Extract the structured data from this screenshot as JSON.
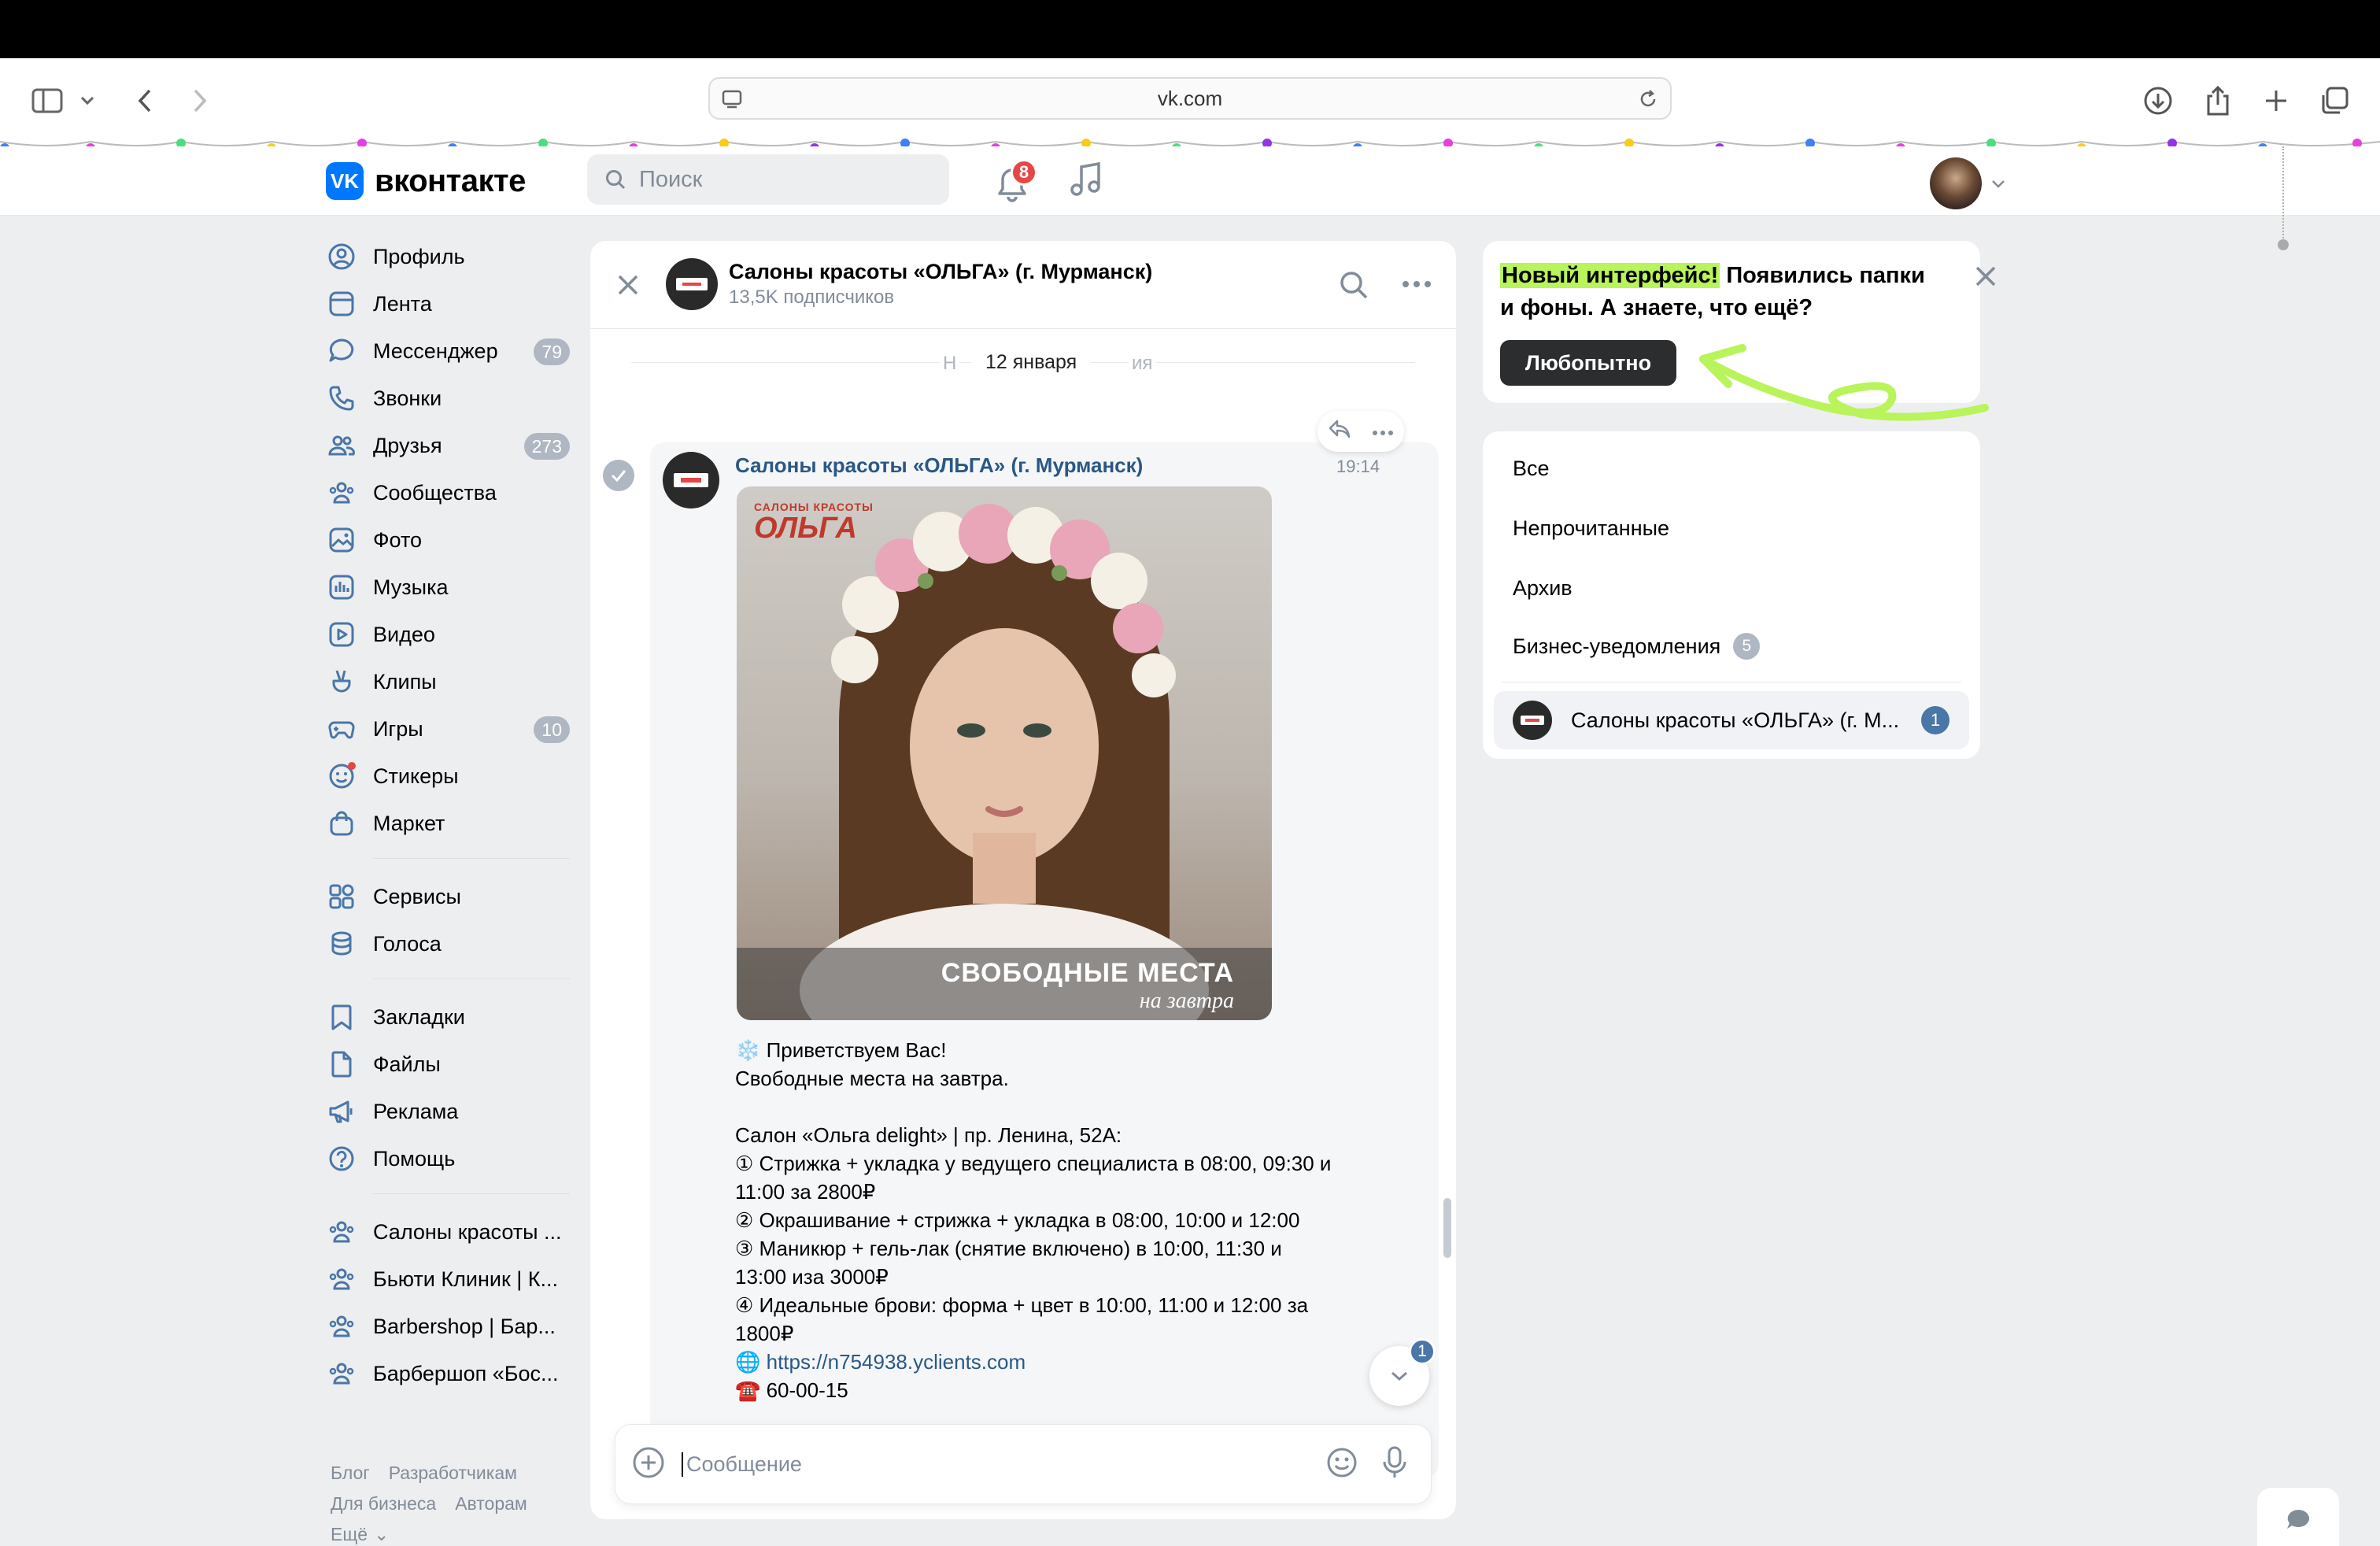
{
  "browser": {
    "url": "vk.com"
  },
  "header": {
    "logo_text": "вконтакте",
    "logo_mark": "VK",
    "search_placeholder": "Поиск",
    "notifications_count": "8"
  },
  "nav": {
    "items": [
      {
        "label": "Профиль",
        "icon": "user-circle-icon"
      },
      {
        "label": "Лента",
        "icon": "feed-icon"
      },
      {
        "label": "Мессенджер",
        "icon": "message-icon",
        "count": "79"
      },
      {
        "label": "Звонки",
        "icon": "phone-icon"
      },
      {
        "label": "Друзья",
        "icon": "friends-icon",
        "count": "273"
      },
      {
        "label": "Сообщества",
        "icon": "communities-icon"
      },
      {
        "label": "Фото",
        "icon": "photo-icon"
      },
      {
        "label": "Музыка",
        "icon": "music-icon"
      },
      {
        "label": "Видео",
        "icon": "video-icon"
      },
      {
        "label": "Клипы",
        "icon": "clips-icon"
      },
      {
        "label": "Игры",
        "icon": "games-icon",
        "count": "10"
      },
      {
        "label": "Стикеры",
        "icon": "stickers-icon"
      },
      {
        "label": "Маркет",
        "icon": "market-icon"
      }
    ],
    "services": [
      {
        "label": "Сервисы",
        "icon": "services-icon"
      },
      {
        "label": "Голоса",
        "icon": "votes-icon"
      }
    ],
    "tools": [
      {
        "label": "Закладки",
        "icon": "bookmark-icon"
      },
      {
        "label": "Файлы",
        "icon": "file-icon"
      },
      {
        "label": "Реклама",
        "icon": "megaphone-icon"
      },
      {
        "label": "Помощь",
        "icon": "help-icon"
      }
    ],
    "groups": [
      {
        "label": "Салоны красоты ...",
        "icon": "communities-icon"
      },
      {
        "label": "Бьюти Клиник | К...",
        "icon": "communities-icon"
      },
      {
        "label": "Barbershop | Бар...",
        "icon": "communities-icon"
      },
      {
        "label": "Барбершоп «Бос...",
        "icon": "communities-icon"
      }
    ]
  },
  "footer": {
    "links_row1": [
      "Блог",
      "Разработчикам"
    ],
    "links_row2": [
      "Для бизнеса",
      "Авторам"
    ],
    "more": "Ещё"
  },
  "chat": {
    "title": "Салоны красоты «ОЛЬГА» (г. Мурманск)",
    "subtitle": "13,5K подписчиков",
    "date_divider": "12 января",
    "date_divider_left": "Н",
    "date_divider_right": "ия",
    "message": {
      "sender": "Салоны красоты «ОЛЬГА» (г. Мурманск)",
      "time": "19:14",
      "photo": {
        "logo_small": "САЛОНЫ КРАСОТЫ",
        "logo_big": "ОЛЬГА",
        "caption_main": "СВОБОДНЫЕ МЕСТА",
        "caption_sub": "на завтра"
      },
      "lines": [
        "❄️ Приветствуем Вас!",
        "Свободные места на завтра.",
        "",
        "Салон «Ольга delight» | пр. Ленина, 52А:",
        "① Стрижка + укладка у ведущего специалиста в 08:00, 09:30 и 11:00 за 2800₽",
        "② Окрашивание + стрижка + укладка в 08:00, 10:00 и 12:00",
        "③ Маникюр + гель-лак (снятие включено) в 10:00, 11:30 и 13:00 иза 3000₽",
        "④ Идеальные брови: форма + цвет в 10:00, 11:00 и 12:00 за 1800₽"
      ],
      "link": "https://n754938.yclients.com",
      "phone": "☎️ 60-00-15"
    },
    "unread_badge": "1",
    "composer_placeholder": "Сообщение"
  },
  "promo": {
    "highlight": "Новый интерфейс!",
    "text": " Появились папки и фоны. А знаете, что ещё?",
    "button": "Любопытно",
    "accent": "#b8f45a"
  },
  "folders": {
    "items": [
      {
        "label": "Все"
      },
      {
        "label": "Непрочитанные"
      },
      {
        "label": "Архив"
      },
      {
        "label": "Бизнес-уведомления",
        "count": "5"
      }
    ],
    "chat_item": {
      "label": "Салоны красоты «ОЛЬГА» (г. М...",
      "count": "1"
    }
  },
  "colors": {
    "vk_blue": "#0077ff",
    "link": "#2a5885",
    "badge_red": "#e64646",
    "counter_gray": "#aeb7c2",
    "page_bg": "#edeef0"
  }
}
